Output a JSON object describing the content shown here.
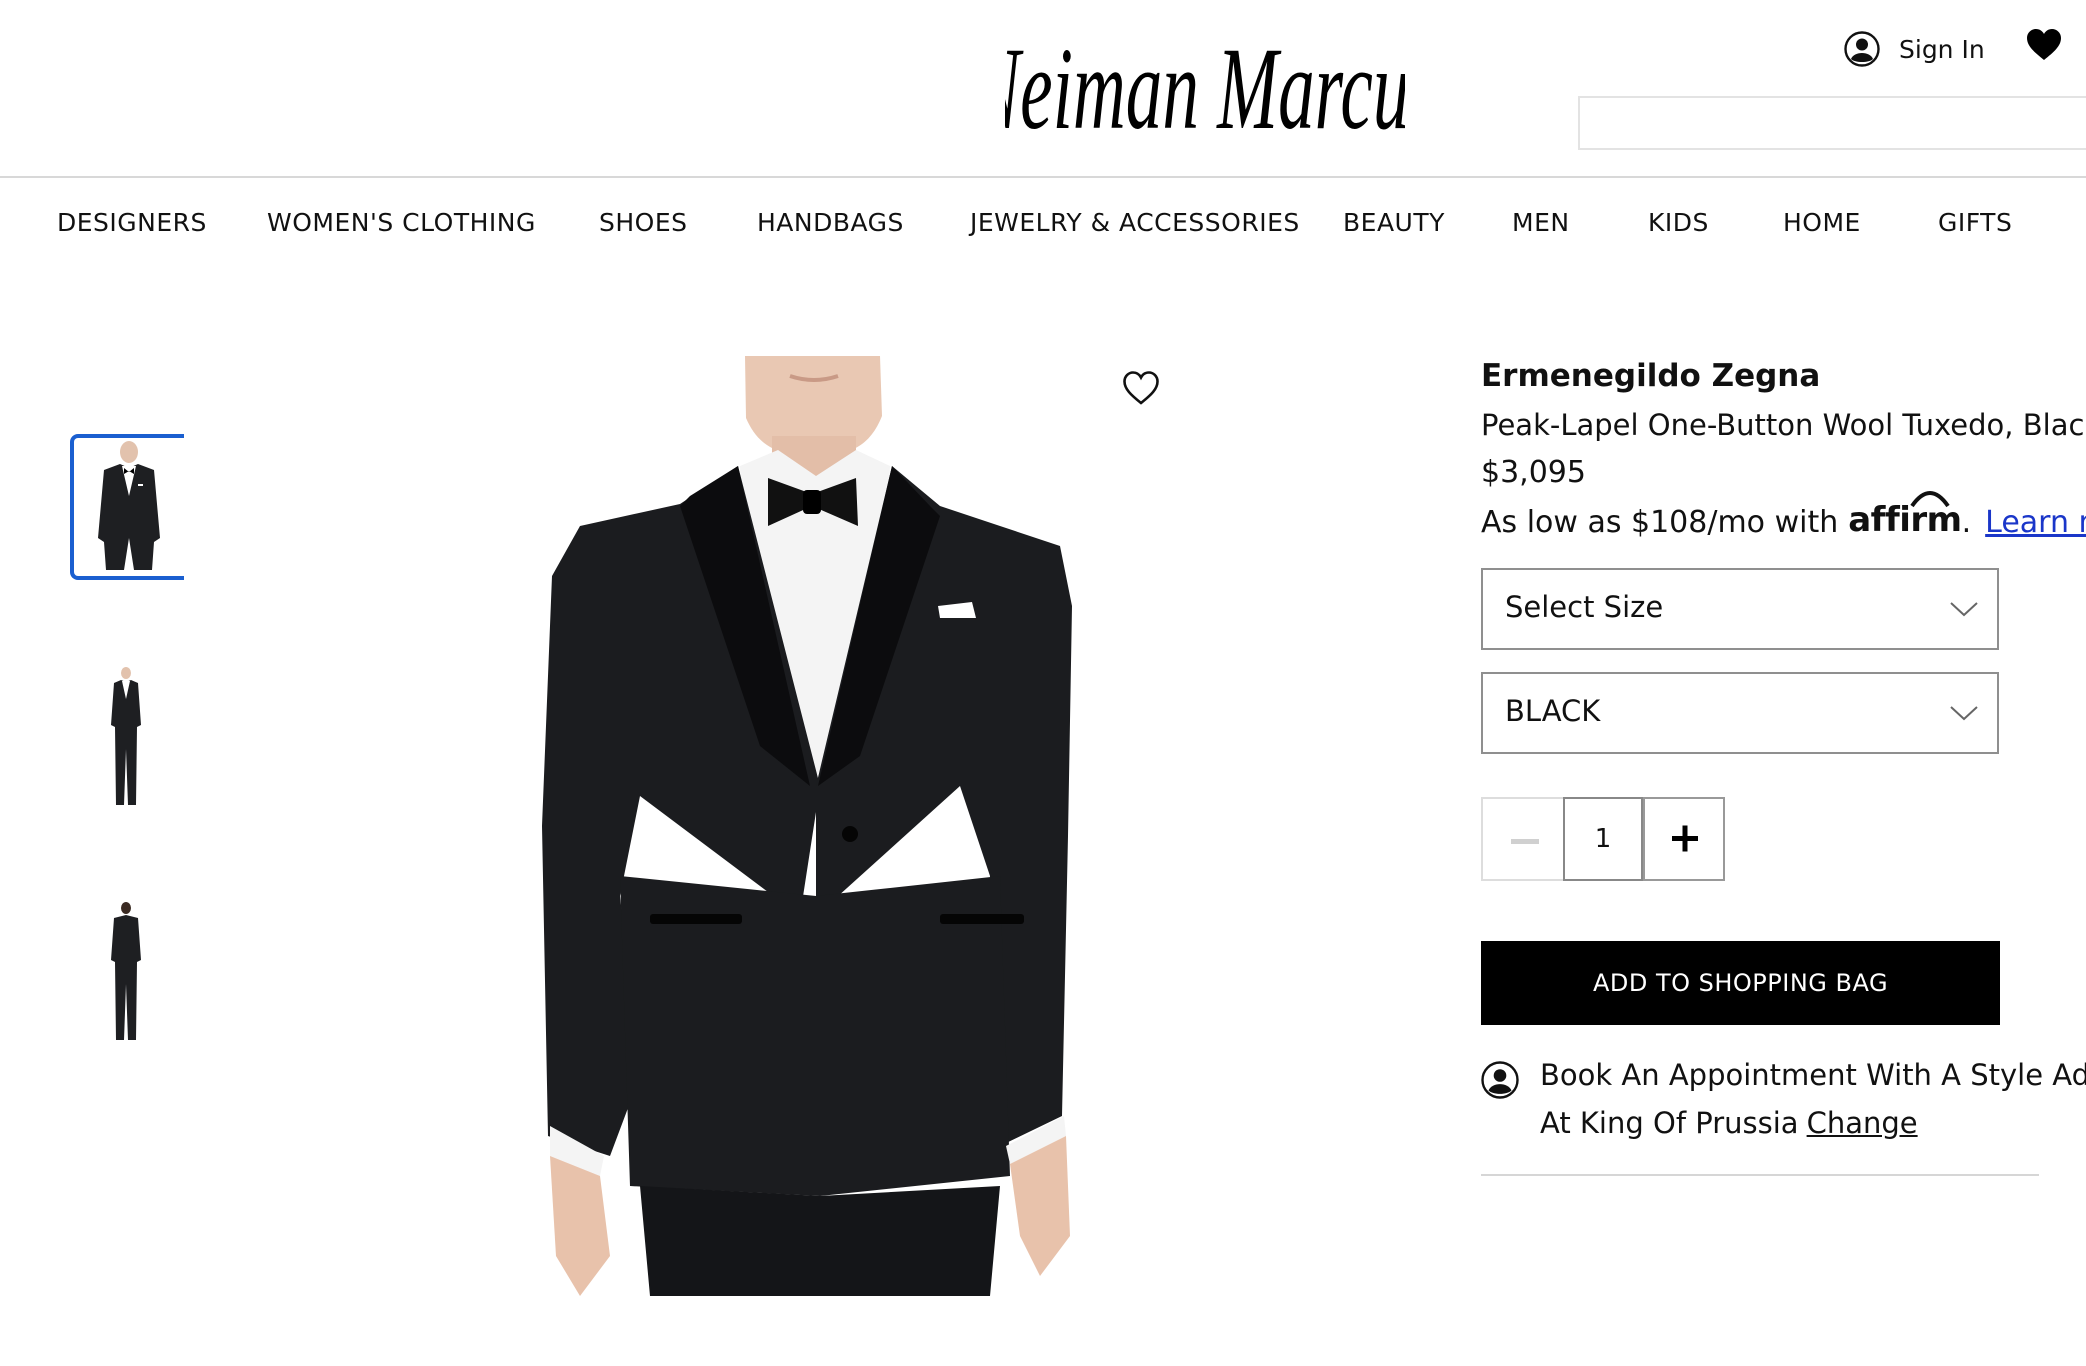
{
  "header": {
    "logo_text": "Neiman Marcus",
    "signin_label": "Sign In",
    "signin_icon": "user-circle-icon",
    "favorites_icon": "heart-icon",
    "search_placeholder": ""
  },
  "nav": {
    "items": [
      {
        "label": "DESIGNERS"
      },
      {
        "label": "WOMEN'S CLOTHING"
      },
      {
        "label": "SHOES"
      },
      {
        "label": "HANDBAGS"
      },
      {
        "label": "JEWELRY & ACCESSORIES"
      },
      {
        "label": "BEAUTY"
      },
      {
        "label": "MEN"
      },
      {
        "label": "KIDS"
      },
      {
        "label": "HOME"
      },
      {
        "label": "GIFTS"
      }
    ]
  },
  "gallery": {
    "thumbnails": [
      "front-view",
      "full-length-front",
      "full-length-back"
    ],
    "active_index": 0,
    "wishlist_icon": "heart-outline-icon"
  },
  "product": {
    "brand": "Ermenegildo Zegna",
    "name": "Peak-Lapel One-Button Wool Tuxedo, Black",
    "price": "$3,095",
    "financing_prefix": "As low as $108/mo with",
    "financing_brand": "affirm",
    "financing_link": "Learn more",
    "size_select": "Select Size",
    "color_select": "BLACK",
    "quantity": "1",
    "add_to_bag": "ADD TO SHOPPING BAG",
    "appointment_line1": "Book An Appointment With A Style Advisor",
    "appointment_line2": "At King Of Prussia",
    "appointment_change": "Change"
  },
  "colors": {
    "accent_blue": "#1a5fd0",
    "link_blue": "#1a36c9",
    "button_black": "#000000"
  }
}
